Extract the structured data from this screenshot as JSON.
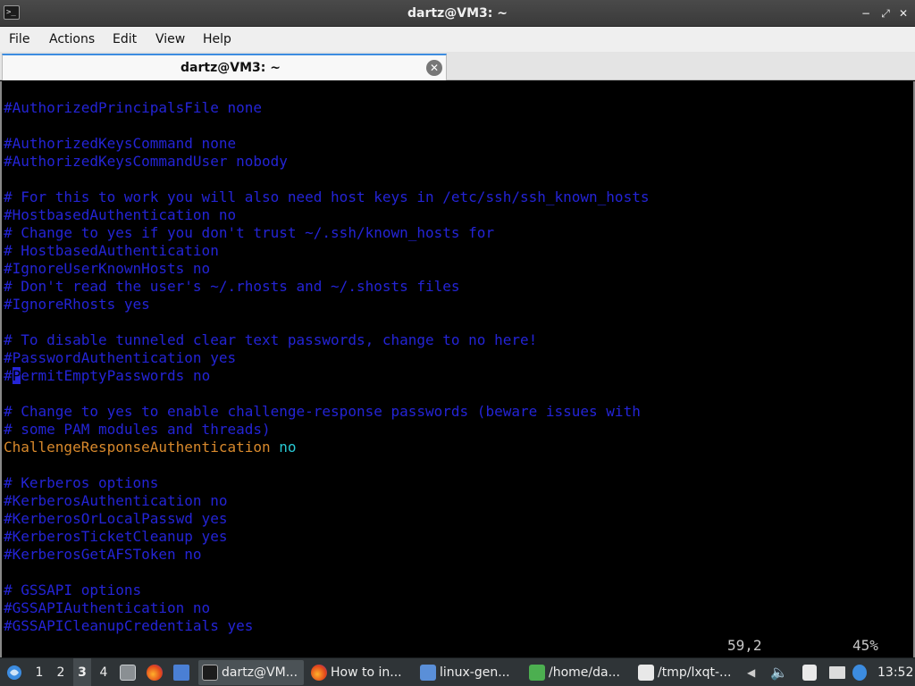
{
  "window": {
    "title": "dartz@VM3: ~",
    "app_icon_glyph": ">_",
    "controls": {
      "minimize": "−",
      "maximize": "⤢",
      "close": "✕"
    }
  },
  "menu": {
    "items": [
      "File",
      "Actions",
      "Edit",
      "View",
      "Help"
    ]
  },
  "tab": {
    "label": "dartz@VM3: ~",
    "close_glyph": "✕"
  },
  "terminal": {
    "lines": [
      {
        "text": "#AuthorizedPrincipalsFile none",
        "style": "comment"
      },
      {
        "text": "",
        "style": "comment"
      },
      {
        "text": "#AuthorizedKeysCommand none",
        "style": "comment"
      },
      {
        "text": "#AuthorizedKeysCommandUser nobody",
        "style": "comment"
      },
      {
        "text": "",
        "style": "comment"
      },
      {
        "text": "# For this to work you will also need host keys in /etc/ssh/ssh_known_hosts",
        "style": "comment"
      },
      {
        "text": "#HostbasedAuthentication no",
        "style": "comment"
      },
      {
        "text": "# Change to yes if you don't trust ~/.ssh/known_hosts for",
        "style": "comment"
      },
      {
        "text": "# HostbasedAuthentication",
        "style": "comment"
      },
      {
        "text": "#IgnoreUserKnownHosts no",
        "style": "comment"
      },
      {
        "text": "# Don't read the user's ~/.rhosts and ~/.shosts files",
        "style": "comment"
      },
      {
        "text": "#IgnoreRhosts yes",
        "style": "comment"
      },
      {
        "text": "",
        "style": "comment"
      },
      {
        "text": "# To disable tunneled clear text passwords, change to no here!",
        "style": "comment"
      },
      {
        "text": "#PasswordAuthentication yes",
        "style": "comment"
      },
      {
        "text": "#PermitEmptyPasswords no",
        "style": "cursor"
      },
      {
        "text": "",
        "style": "comment"
      },
      {
        "text": "# Change to yes to enable challenge-response passwords (beware issues with",
        "style": "comment"
      },
      {
        "text": "# some PAM modules and threads)",
        "style": "comment"
      },
      {
        "text": "ChallengeResponseAuthentication",
        "value": " no",
        "style": "directive"
      },
      {
        "text": "",
        "style": "comment"
      },
      {
        "text": "# Kerberos options",
        "style": "comment"
      },
      {
        "text": "#KerberosAuthentication no",
        "style": "comment"
      },
      {
        "text": "#KerberosOrLocalPasswd yes",
        "style": "comment"
      },
      {
        "text": "#KerberosTicketCleanup yes",
        "style": "comment"
      },
      {
        "text": "#KerberosGetAFSToken no",
        "style": "comment"
      },
      {
        "text": "",
        "style": "comment"
      },
      {
        "text": "# GSSAPI options",
        "style": "comment"
      },
      {
        "text": "#GSSAPIAuthentication no",
        "style": "comment"
      },
      {
        "text": "#GSSAPICleanupCredentials yes",
        "style": "comment"
      }
    ],
    "status": {
      "position": "59,2",
      "percent": "45%"
    }
  },
  "taskbar": {
    "start_icon": "lxqt-start-icon",
    "workspaces": [
      "1",
      "2",
      "3",
      "4"
    ],
    "active_workspace": "3",
    "tasks": [
      {
        "label": "dartz@VM...",
        "icon": "terminal-icon",
        "active": true
      },
      {
        "label": "How to in...",
        "icon": "firefox-icon",
        "active": false
      },
      {
        "label": "linux-gen...",
        "icon": "folder-icon",
        "active": false
      },
      {
        "label": "/home/da...",
        "icon": "text-editor-icon",
        "active": false
      },
      {
        "label": "/tmp/lxqt-...",
        "icon": "edit-icon",
        "active": false
      }
    ],
    "clock": "13:52"
  },
  "colors": {
    "comment": "#2424d6",
    "directive": "#d8892c",
    "value": "#28c9d4",
    "status": "#c8c8c8"
  }
}
